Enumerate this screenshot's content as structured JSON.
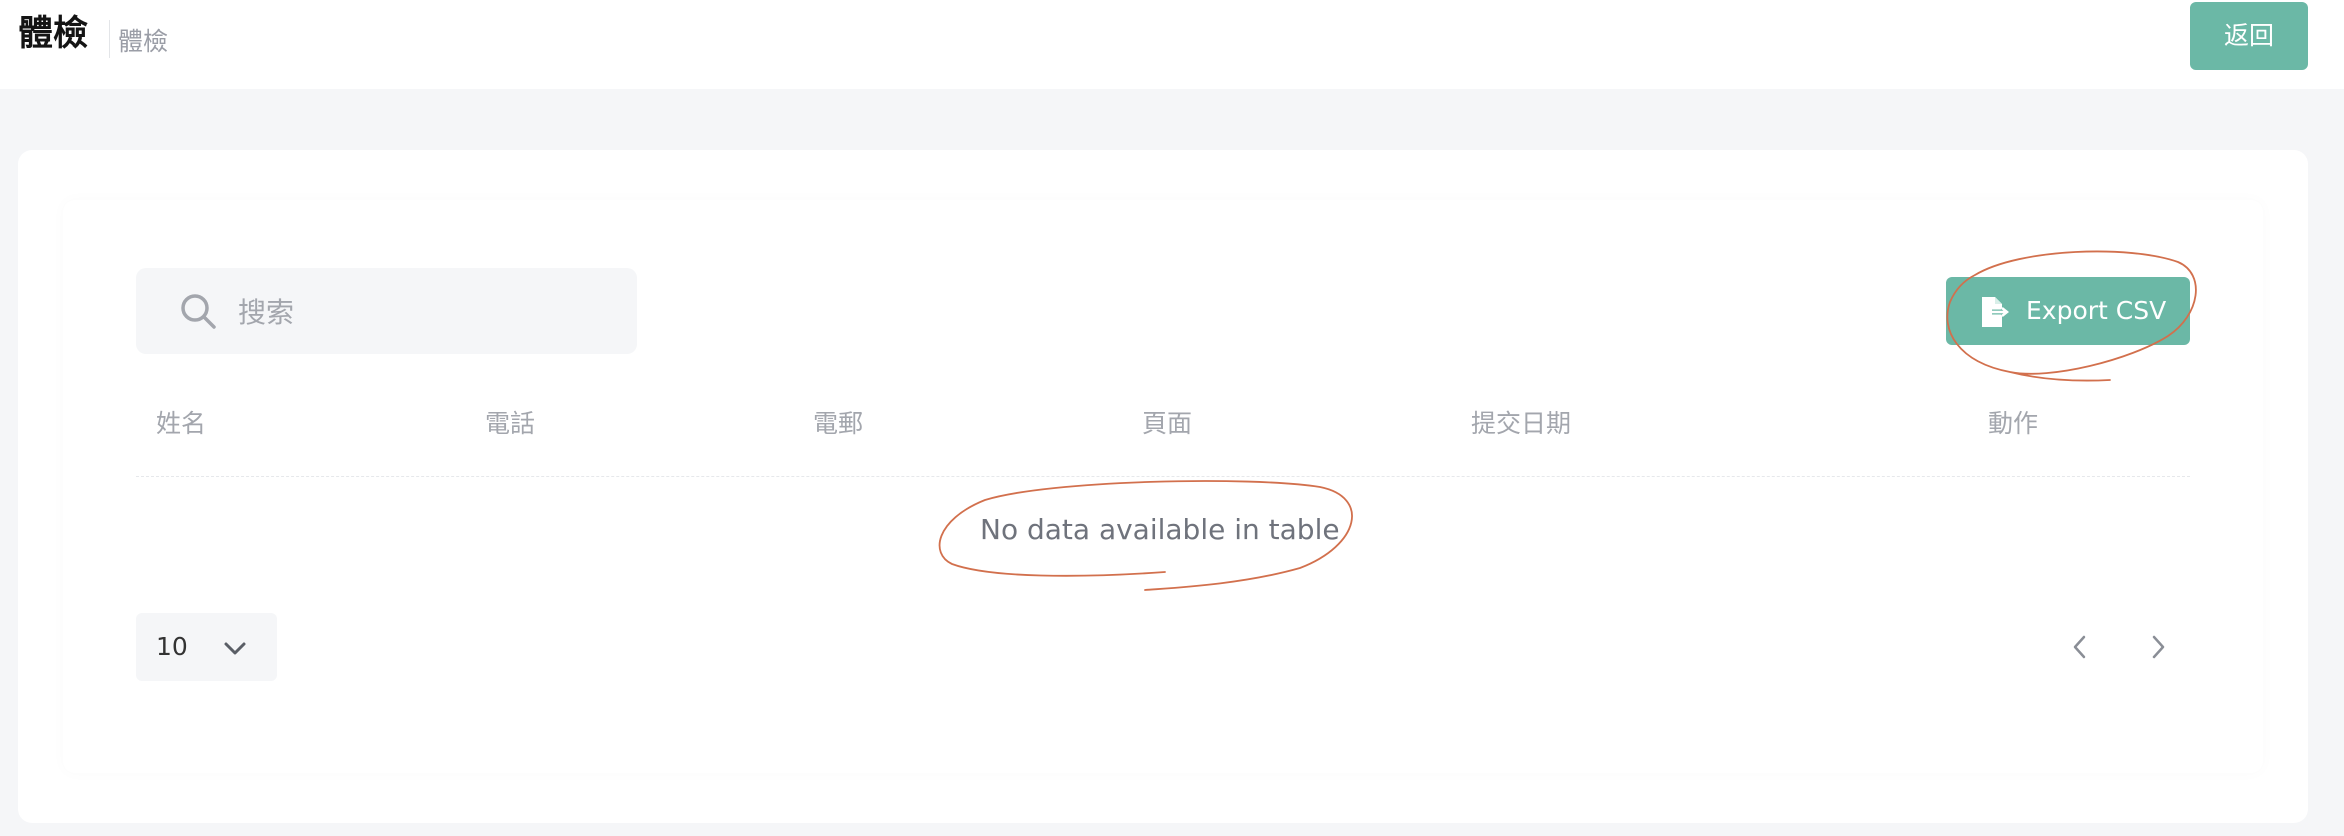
{
  "header": {
    "title": "體檢",
    "breadcrumb": "體檢",
    "back_label": "返回"
  },
  "toolbar": {
    "search_placeholder": "搜索",
    "export_label": "Export CSV"
  },
  "table": {
    "columns": [
      "姓名",
      "電話",
      "電郵",
      "頁面",
      "提交日期",
      "動作"
    ],
    "rows": [],
    "empty_message": "No data available in table"
  },
  "pagination": {
    "page_length": "10"
  },
  "colors": {
    "accent": "#6bb8a6",
    "annotation": "#d2704d",
    "background": "#f5f6f8"
  },
  "icons": [
    "search-icon",
    "file-export-icon",
    "chevron-down-icon",
    "chevron-left-icon",
    "chevron-right-icon"
  ]
}
